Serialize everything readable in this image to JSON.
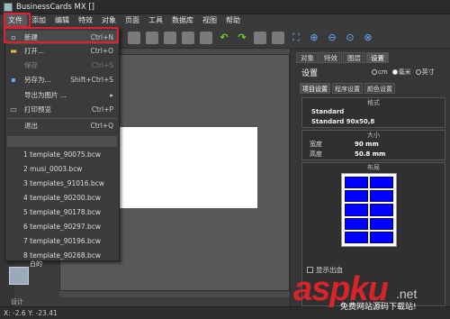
{
  "window": {
    "title": "BusinessCards MX []"
  },
  "menubar": [
    "文件",
    "添加",
    "编辑",
    "特效",
    "对象",
    "页面",
    "工具",
    "数据库",
    "视图",
    "帮助"
  ],
  "file_menu": {
    "items": [
      {
        "label": "新建",
        "shortcut": "Ctrl+N",
        "icon": "new-file-icon",
        "disabled": false,
        "highlighted": true
      },
      {
        "label": "打开...",
        "shortcut": "Ctrl+O",
        "icon": "folder-open-icon",
        "disabled": false
      },
      {
        "label": "保存",
        "shortcut": "Ctrl+S",
        "icon": "save-icon",
        "disabled": true
      },
      {
        "label": "另存为...",
        "shortcut": "Shift+Ctrl+S",
        "icon": "save-as-icon",
        "disabled": false
      },
      {
        "label": "导出为图片 ...",
        "shortcut": "▸",
        "icon": "export-image-icon",
        "disabled": false
      },
      {
        "label": "打印预览",
        "shortcut": "Ctrl+P",
        "icon": "print-preview-icon",
        "disabled": false
      },
      {
        "label": "退出",
        "shortcut": "Ctrl+Q",
        "icon": "",
        "disabled": false
      }
    ],
    "recent": [
      "1 template_90075.bcw",
      "2 musi_0003.bcw",
      "3 templates_91016.bcw",
      "4 template_90200.bcw",
      "5 template_90178.bcw",
      "6 template_90297.bcw",
      "7 template_90196.bcw",
      "8 template_90268.bcw"
    ]
  },
  "right_panel": {
    "tabs": [
      "对象",
      "特效",
      "图层",
      "设置"
    ],
    "header": "设置",
    "units": [
      "cm",
      "毫米",
      "英寸"
    ],
    "selected_unit": "毫米",
    "sub_tabs": [
      "项目设置",
      "程序设置",
      "颜色设置"
    ],
    "format_title": "格式",
    "format_lines": [
      "Standard",
      "Standard 90x50,8"
    ],
    "size_title": "大小",
    "width_label": "宽度",
    "width_value": "90 mm",
    "height_label": "高度",
    "height_value": "50.8 mm",
    "layout_title": "布局",
    "show_bleed_label": "显示出血"
  },
  "thumbnail_label": "白的",
  "bottom_label": "设计",
  "status": {
    "coords": "X: -2.6 Y: -23.41"
  },
  "watermark": {
    "main": "aspku",
    "suffix": ".net",
    "sub": "免费网站源码下载站!"
  }
}
